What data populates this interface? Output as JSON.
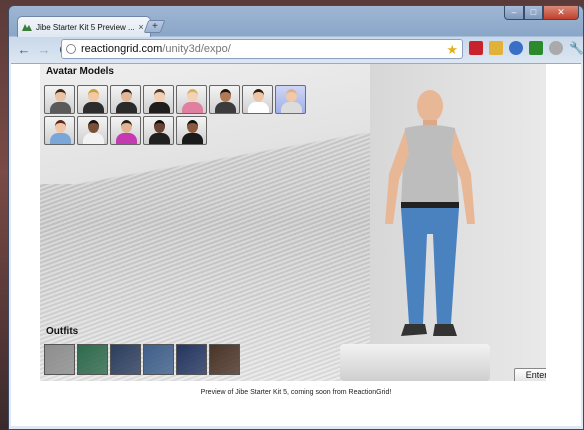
{
  "browser": {
    "tab_title": "Jibe Starter Kit 5 Preview ...",
    "tab_close": "×",
    "new_tab": "+",
    "window_controls": {
      "minimize": "–",
      "maximize": "□",
      "close": "✕"
    },
    "nav": {
      "back": "←",
      "forward": "→",
      "reload": "C"
    },
    "url_host": "reactiongrid.com",
    "url_path": "/unity3d/expo/",
    "bookmark_star": "★"
  },
  "page": {
    "models_title": "Avatar Models",
    "outfits_title": "Outfits",
    "enter_button": "Enter Jibe",
    "caption": "Preview of Jibe Starter Kit 5, coming soon from ReactionGrid!"
  },
  "avatars": [
    {
      "skin": "#e9c4a6",
      "shirt": "#5a5a5a",
      "hair": "#3a2a1c"
    },
    {
      "skin": "#f0c9a8",
      "shirt": "#2d2d2d",
      "hair": "#c9a03a"
    },
    {
      "skin": "#e3b898",
      "shirt": "#2a2a2a",
      "hair": "#2a1e16"
    },
    {
      "skin": "#f2cfb3",
      "shirt": "#1e1e1e",
      "hair": "#4a3a2a"
    },
    {
      "skin": "#f3d2b8",
      "shirt": "#e07fa0",
      "hair": "#d7b25c"
    },
    {
      "skin": "#b07a56",
      "shirt": "#3c3c3c",
      "hair": "#1e1410"
    },
    {
      "skin": "#eec4a4",
      "shirt": "#ffffff",
      "hair": "#2c1c12"
    },
    {
      "skin": "#f2c9a8",
      "shirt": "#dcdcdc",
      "hair": "#d9b398",
      "selected": true
    },
    {
      "skin": "#f0c6a6",
      "shirt": "#7aa7d8",
      "hair": "#5a2a1a"
    },
    {
      "skin": "#7a5038",
      "shirt": "#f2f2f2",
      "hair": "#1a1210"
    },
    {
      "skin": "#e2b493",
      "shirt": "#c43ab0",
      "hair": "#2a1e16"
    },
    {
      "skin": "#6a4430",
      "shirt": "#202020",
      "hair": "#140e0a"
    },
    {
      "skin": "#8a5a3e",
      "shirt": "#1a1a1a",
      "hair": "#140e0a"
    }
  ],
  "outfits": [
    "#8e8e8e",
    "#2e6a4c",
    "#2c3e5e",
    "#3f5f8a",
    "#253660",
    "#4a3428"
  ],
  "colors": {
    "accent": "#3b5574",
    "star": "#e2b21e"
  }
}
